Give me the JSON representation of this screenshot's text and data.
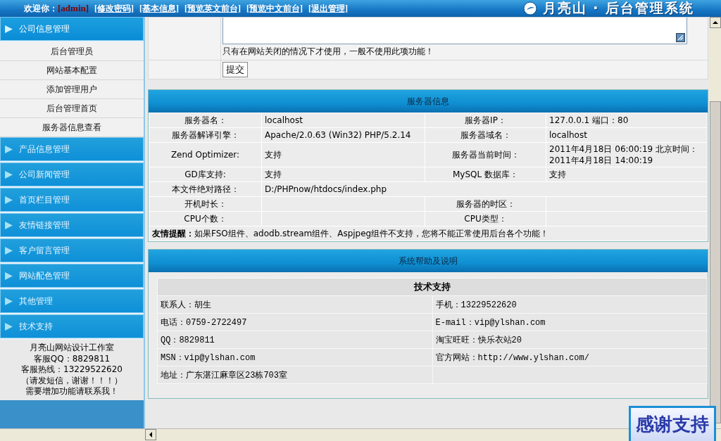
{
  "header": {
    "welcome_label": "欢迎你：",
    "username": "[admin]",
    "links": [
      "[修改密码]",
      "[基本信息]",
      "[预览英文前台]",
      "[预览中文前台]",
      "[退出管理]"
    ],
    "logo_text": "月亮山 · 后台管理系统"
  },
  "sidebar": {
    "sections": [
      {
        "label": "公司信息管理",
        "expanded": true,
        "children": [
          {
            "label": "后台管理员"
          },
          {
            "label": "网站基本配置"
          },
          {
            "label": "添加管理用户"
          },
          {
            "label": "后台管理首页"
          },
          {
            "label": "服务器信息查看"
          }
        ]
      },
      {
        "label": "产品信息管理",
        "expanded": false
      },
      {
        "label": "公司新闻管理",
        "expanded": false
      },
      {
        "label": "首页栏目管理",
        "expanded": false
      },
      {
        "label": "友情链接管理",
        "expanded": false
      },
      {
        "label": "客户留言管理",
        "expanded": false
      },
      {
        "label": "网站配色管理",
        "expanded": false
      },
      {
        "label": "其他管理",
        "expanded": false
      },
      {
        "label": "技术支持",
        "expanded": false
      }
    ],
    "contact_lines": [
      "月亮山网站设计工作室",
      "客服QQ：8829811",
      "客服热线：13229522620",
      "（请发短信，谢谢！！！）",
      "需要增加功能请联系我！"
    ]
  },
  "form": {
    "note": "只有在网站关闭的情况下才使用，一般不使用此项功能！",
    "submit": "提交"
  },
  "server_info": {
    "title": "服务器信息",
    "rows": [
      [
        {
          "label": "服务器名：",
          "value": "localhost"
        },
        {
          "label": "服务器IP：",
          "value": "127.0.0.1 端口：80"
        }
      ],
      [
        {
          "label": "服务器解译引擎：",
          "value": "Apache/2.0.63 (Win32) PHP/5.2.14"
        },
        {
          "label": "服务器域名：",
          "value": "localhost"
        }
      ],
      [
        {
          "label": "Zend Optimizer:",
          "value": "支持"
        },
        {
          "label": "服务器当前时间：",
          "value": "2011年4月18日  06:00:19 北京时间：\n2011年4月18日  14:00:19"
        }
      ],
      [
        {
          "label": "GD库支持:",
          "value": "支持"
        },
        {
          "label": "MySQL 数据库：",
          "value": "支持"
        }
      ],
      [
        {
          "label": "本文件绝对路径：",
          "value": "D:/PHPnow/htdocs/index.php"
        }
      ],
      [
        {
          "label": "开机时长："
        },
        {
          "label": "服务器的时区："
        }
      ],
      [
        {
          "label": "CPU个数："
        },
        {
          "label": "CPU类型："
        }
      ]
    ],
    "notice": "**友情提醒：**如果FSO组件、adodb.stream组件、Aspjpeg组件不支持，您将不能正常使用后台各个功能！"
  },
  "help": {
    "title": "系统帮助及说明",
    "subtitle": "技术支持",
    "rows": [
      [
        "联系人：胡生",
        "手机：13229522620"
      ],
      [
        "电话：0759-2722497",
        "E-mail：vip@ylshan.com"
      ],
      [
        "QQ：8829811",
        "淘宝旺旺：快乐衣站20"
      ],
      [
        "MSN：vip@ylshan.com",
        "官方网站：http://www.ylshan.com/"
      ],
      [
        "地址：广东湛江麻章区23栋703室"
      ]
    ]
  },
  "floating_badge": "感谢支持"
}
